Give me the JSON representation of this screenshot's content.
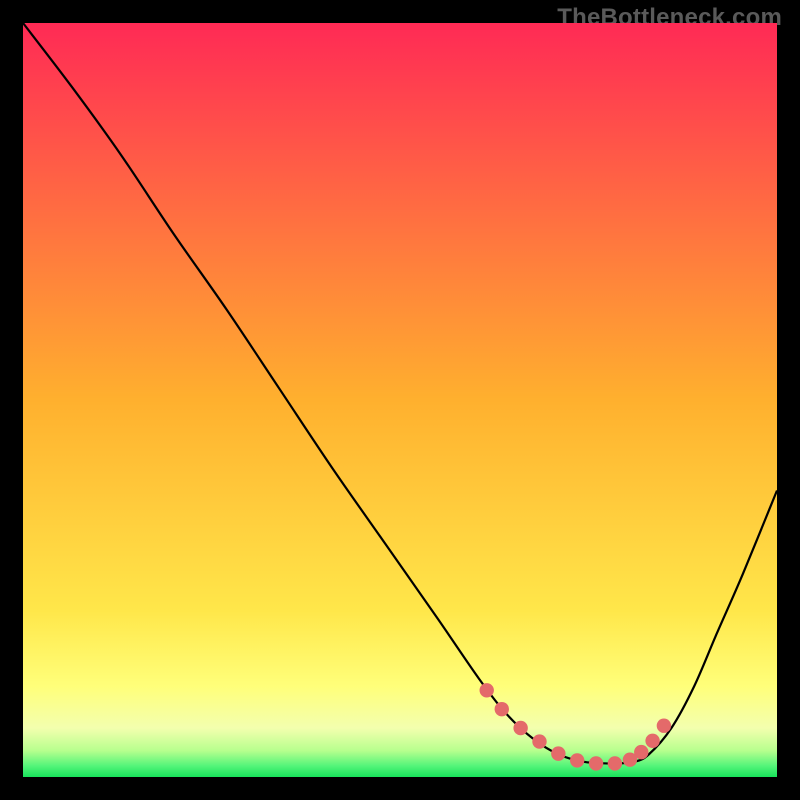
{
  "watermark": "TheBottleneck.com",
  "colors": {
    "frame": "#000000",
    "curve": "#000000",
    "marker_fill": "#e46a6a",
    "marker_stroke": "#c84f4f",
    "band_green": "#18e35b"
  },
  "chart_data": {
    "type": "line",
    "title": "",
    "xlabel": "",
    "ylabel": "",
    "xlim": [
      0,
      100
    ],
    "ylim": [
      0,
      100
    ],
    "gradient_stops": [
      {
        "pos": 0.0,
        "color": "#ff2a55"
      },
      {
        "pos": 0.5,
        "color": "#ffb02e"
      },
      {
        "pos": 0.78,
        "color": "#ffe74a"
      },
      {
        "pos": 0.88,
        "color": "#ffff7a"
      },
      {
        "pos": 0.935,
        "color": "#f3ffae"
      },
      {
        "pos": 0.965,
        "color": "#b7ff8e"
      },
      {
        "pos": 0.985,
        "color": "#55f57a"
      },
      {
        "pos": 1.0,
        "color": "#18e35b"
      }
    ],
    "series": [
      {
        "name": "bottleneck-curve",
        "x": [
          0.0,
          6.5,
          13.0,
          20.0,
          27.0,
          34.0,
          41.0,
          48.0,
          55.0,
          60.5,
          64.0,
          67.5,
          71.0,
          74.5,
          78.0,
          81.0,
          83.0,
          86.0,
          89.0,
          92.0,
          95.5,
          100.0
        ],
        "y": [
          100.0,
          91.5,
          82.5,
          72.0,
          62.0,
          51.5,
          41.0,
          31.0,
          21.0,
          13.0,
          8.5,
          5.2,
          3.0,
          2.0,
          1.8,
          2.0,
          3.0,
          6.5,
          12.0,
          19.0,
          27.0,
          38.0
        ]
      }
    ],
    "markers": {
      "name": "highlight-dots",
      "x": [
        61.5,
        63.5,
        66.0,
        68.5,
        71.0,
        73.5,
        76.0,
        78.5,
        80.5,
        82.0,
        83.5,
        85.0
      ],
      "y": [
        11.5,
        9.0,
        6.5,
        4.7,
        3.1,
        2.2,
        1.8,
        1.8,
        2.3,
        3.3,
        4.8,
        6.8
      ]
    }
  }
}
